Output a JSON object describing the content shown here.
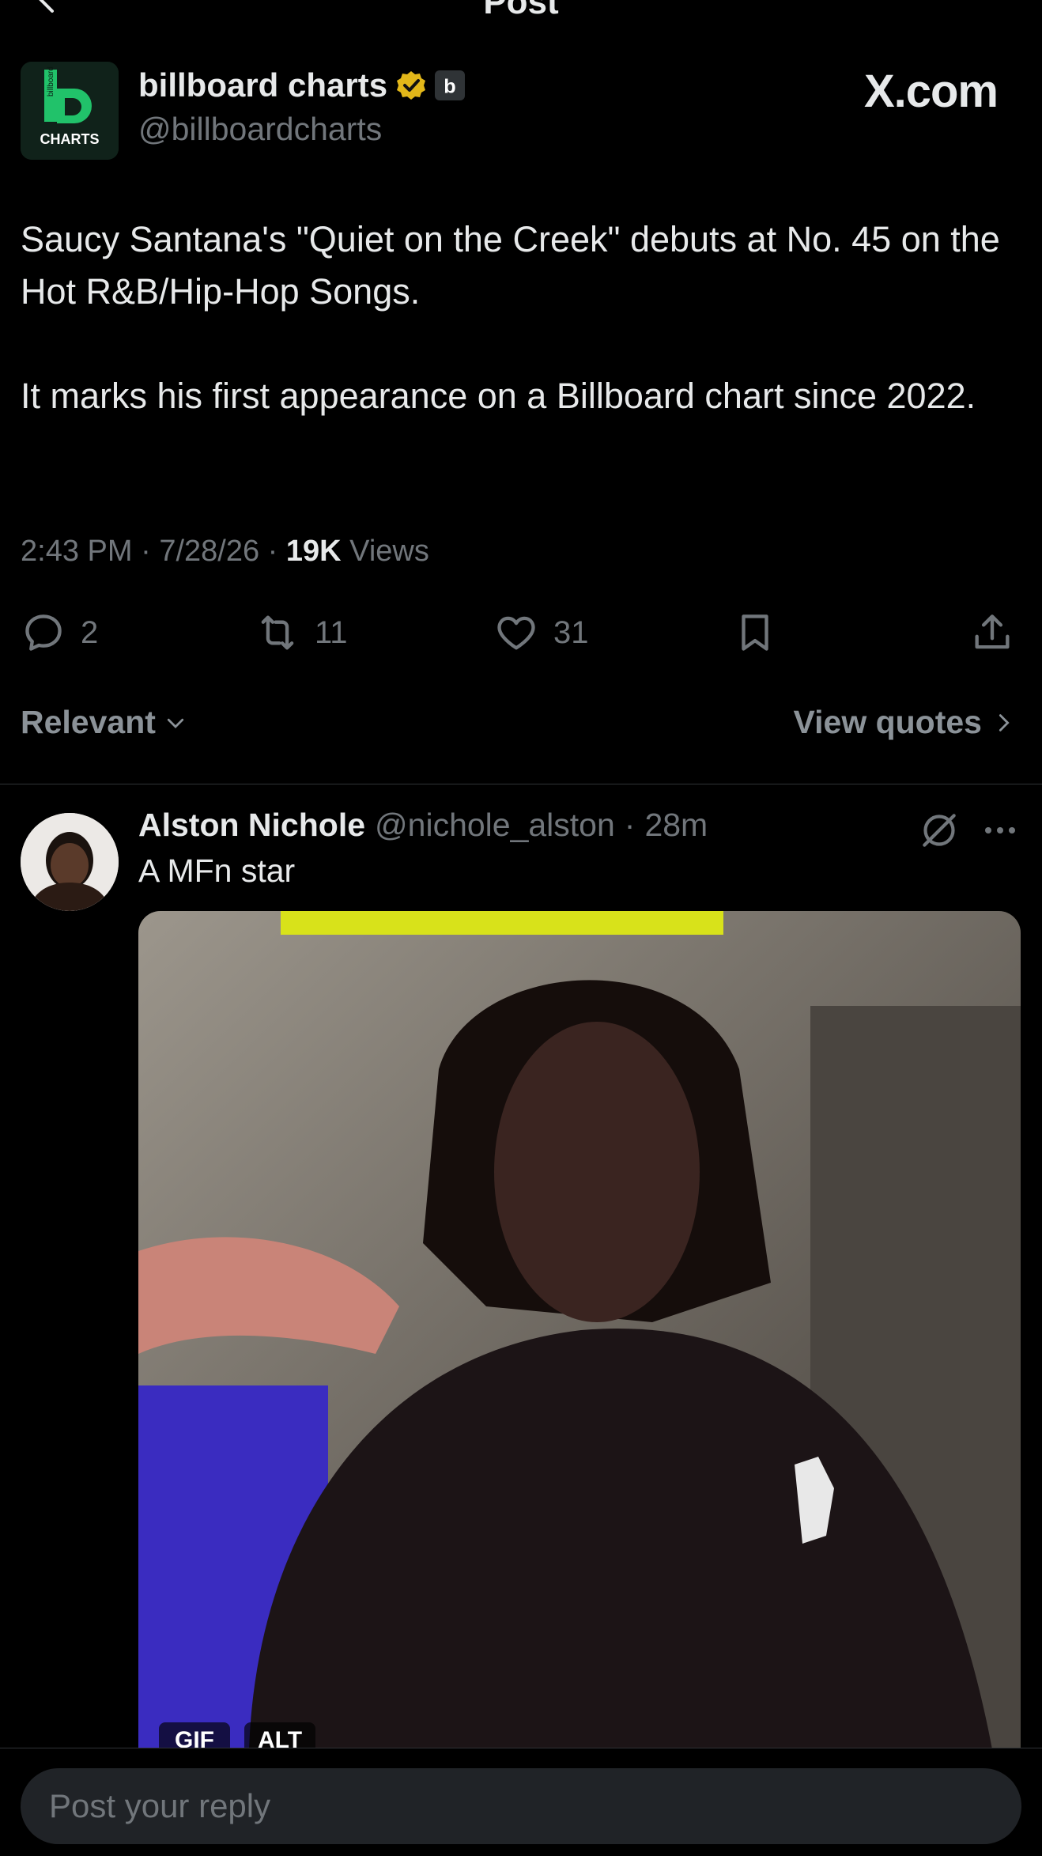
{
  "nav": {
    "title": "Post"
  },
  "post": {
    "display_name": "billboard charts",
    "handle": "@billboardcharts",
    "avatar_text": {
      "top": "billboard",
      "letter": "b",
      "bottom": "CHARTS"
    },
    "affiliate_badge": "b",
    "watermark": "X.com",
    "paragraphs": [
      "Saucy Santana's \"Quiet on the Creek\" debuts at No. 45 on the Hot R&B/Hip-Hop Songs.",
      "It marks his first appearance on a Billboard chart since 2022."
    ],
    "time": "2:43 PM",
    "date": "7/28/26",
    "views_count": "19K",
    "views_label": "Views",
    "sep": "·"
  },
  "actions": {
    "replies": "2",
    "reposts": "11",
    "likes": "31"
  },
  "sort": {
    "label": "Relevant",
    "quotes_label": "View quotes"
  },
  "reply": {
    "name": "Alston Nichole",
    "handle": "@nichole_alston",
    "sep": "·",
    "time": "28m",
    "text": "A MFn star",
    "media_chips": [
      "GIF",
      "ALT"
    ]
  },
  "composer": {
    "placeholder": "Post your reply"
  },
  "colors": {
    "background": "#000000",
    "muted": "#71767b",
    "verified_gold": "#e2b719",
    "text": "#e7e9ea"
  }
}
